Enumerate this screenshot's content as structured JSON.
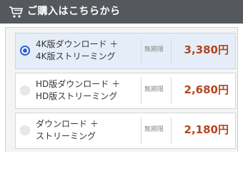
{
  "header": {
    "title": "ご購入はこちらから",
    "icon": "cart-icon",
    "background": "#55585d"
  },
  "plans": [
    {
      "line1": "4K版ダウンロード ＋",
      "line2": "4K版ストリーミング",
      "period": "無期限",
      "price": "3,380円",
      "selected": true
    },
    {
      "line1": "HD版ダウンロード ＋",
      "line2": "HD版ストリーミング",
      "period": "無期限",
      "price": "2,680円",
      "selected": false
    },
    {
      "line1": "ダウンロード ＋",
      "line2": "ストリーミング",
      "period": "無期限",
      "price": "2,180円",
      "selected": false
    }
  ],
  "colors": {
    "price": "#b5451f",
    "radio_selected": "#2f5fd0",
    "selected_row": "#e5eef8"
  }
}
